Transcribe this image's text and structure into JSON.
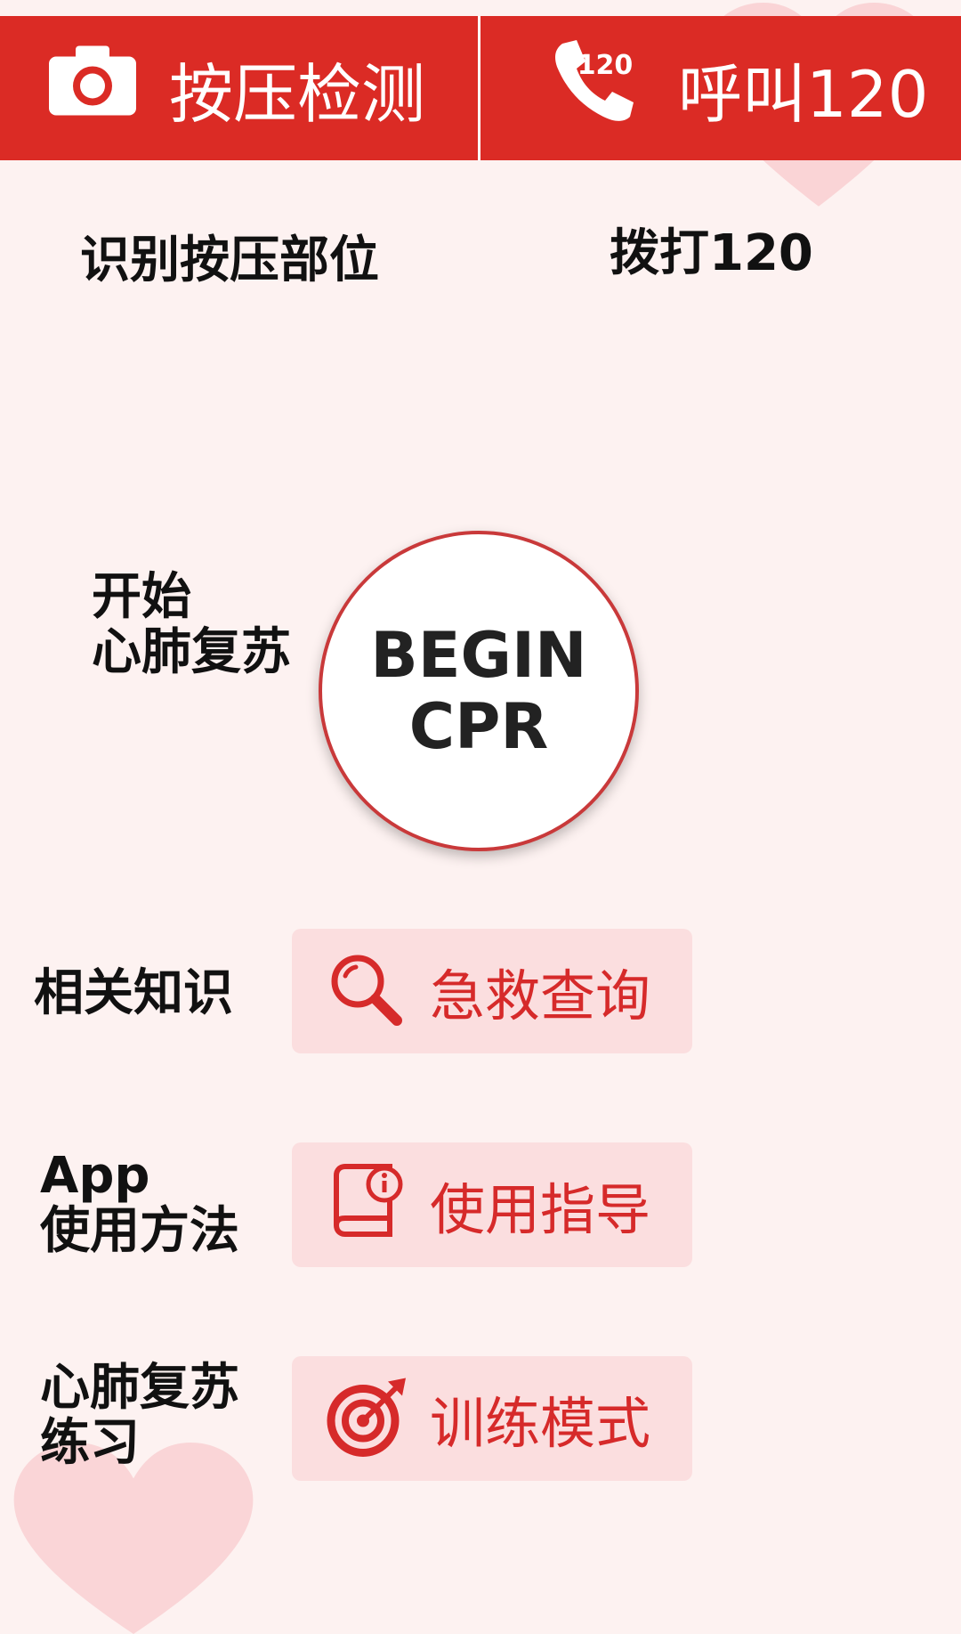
{
  "topbar": {
    "left": {
      "label": "按压检测",
      "icon": "camera-icon"
    },
    "right": {
      "label": "呼叫120",
      "icon": "phone-120-icon",
      "badge": "120"
    }
  },
  "captions": {
    "detect": "识别按压部位",
    "dial": "拨打120",
    "start_line1": "开始",
    "start_line2": "心肺复苏",
    "knowledge": "相关知识",
    "app_line1": "App",
    "app_line2": "使用方法",
    "practice_line1": "心肺复苏",
    "practice_line2": "练习"
  },
  "begin_button": {
    "line1": "BEGIN",
    "line2": "CPR"
  },
  "menu": {
    "search": {
      "label": "急救查询",
      "icon": "search-icon"
    },
    "guide": {
      "label": "使用指导",
      "icon": "book-info-icon"
    },
    "training": {
      "label": "训练模式",
      "icon": "target-icon"
    }
  },
  "colors": {
    "accent": "#db2b25",
    "background": "#fdf2f1",
    "button_bg": "#fbdedf",
    "button_text": "#d62a2a"
  }
}
